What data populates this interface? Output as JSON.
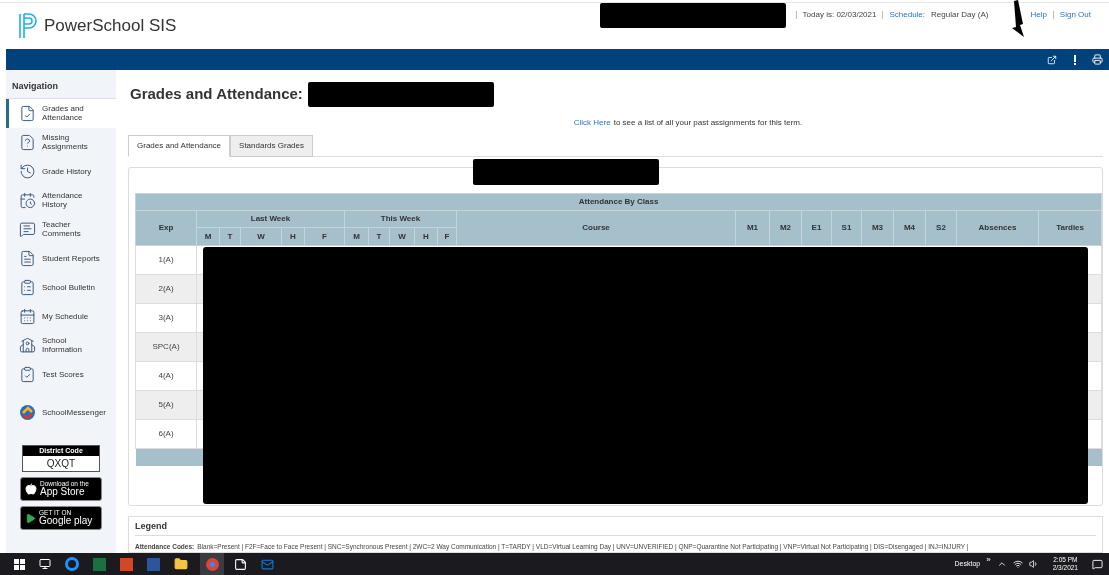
{
  "header": {
    "logo_text": "PowerSchool SIS",
    "today": "Today is: 02/03/2021",
    "schedule_label": "Schedule:",
    "schedule_value": "Regular Day (A)",
    "links": [
      "Help",
      "Sign Out"
    ]
  },
  "nav": {
    "title": "Navigation",
    "items": [
      {
        "label": "Grades and Attendance",
        "selected": true
      },
      {
        "label": "Missing Assignments",
        "selected": false
      },
      {
        "label": "Grade History",
        "selected": false
      },
      {
        "label": "Attendance History",
        "selected": false
      },
      {
        "label": "Teacher Comments",
        "selected": false
      },
      {
        "label": "Student Reports",
        "selected": false
      },
      {
        "label": "School Bulletin",
        "selected": false
      },
      {
        "label": "My Schedule",
        "selected": false
      },
      {
        "label": "School Information",
        "selected": false
      },
      {
        "label": "Test Scores",
        "selected": false
      },
      {
        "label": "SchoolMessenger",
        "selected": false
      }
    ]
  },
  "district_code": {
    "label": "District Code",
    "code": "QXQT"
  },
  "store_badges": [
    {
      "kind": "apple",
      "small": "Download on the",
      "big": "App Store"
    },
    {
      "kind": "google",
      "small": "GET IT ON",
      "big": "Google play"
    }
  ],
  "page_title": "Grades and Attendance:",
  "notice": {
    "link": "Click Here",
    "text": "to see a list of all your past assignments for this term."
  },
  "tabs": [
    {
      "label": "Grades and Attendance",
      "selected": true
    },
    {
      "label": "Standards Grades",
      "selected": false
    }
  ],
  "table": {
    "title": "Attendance By Class",
    "exp": "Exp",
    "last_week": "Last Week",
    "this_week": "This Week",
    "days_last": [
      "M",
      "T",
      "W",
      "H",
      "F"
    ],
    "days_this": [
      "M",
      "T",
      "W",
      "H",
      "F"
    ],
    "course": "Course",
    "terms": [
      "M1",
      "M2",
      "E1",
      "S1",
      "M3",
      "M4",
      "S2"
    ],
    "absences": "Absences",
    "tardies": "Tardies",
    "rows": [
      {
        "exp": "1(A)"
      },
      {
        "exp": "2(A)"
      },
      {
        "exp": "3(A)"
      },
      {
        "exp": "SPC(A)"
      },
      {
        "exp": "4(A)"
      },
      {
        "exp": "5(A)"
      },
      {
        "exp": "6(A)"
      }
    ]
  },
  "legend": {
    "title": "Legend",
    "codes_label": "Attendance Codes:",
    "codes": "Blank=Present | F2F=Face to Face Present | SNC=Synchronous Present | 2WC=2 Way Communication | T=TARDY | VLD=Virtual Learning Day | UNV=UNVERIFIED | QNP=Quarantine Not Participating | VNP=Virtual Not Participating | DIS=Disengaged | INJ=INJURY |"
  },
  "taskbar": {
    "desktop": "Desktop",
    "chevron": "»",
    "time": "2:05 PM",
    "date": "2/3/2021"
  }
}
